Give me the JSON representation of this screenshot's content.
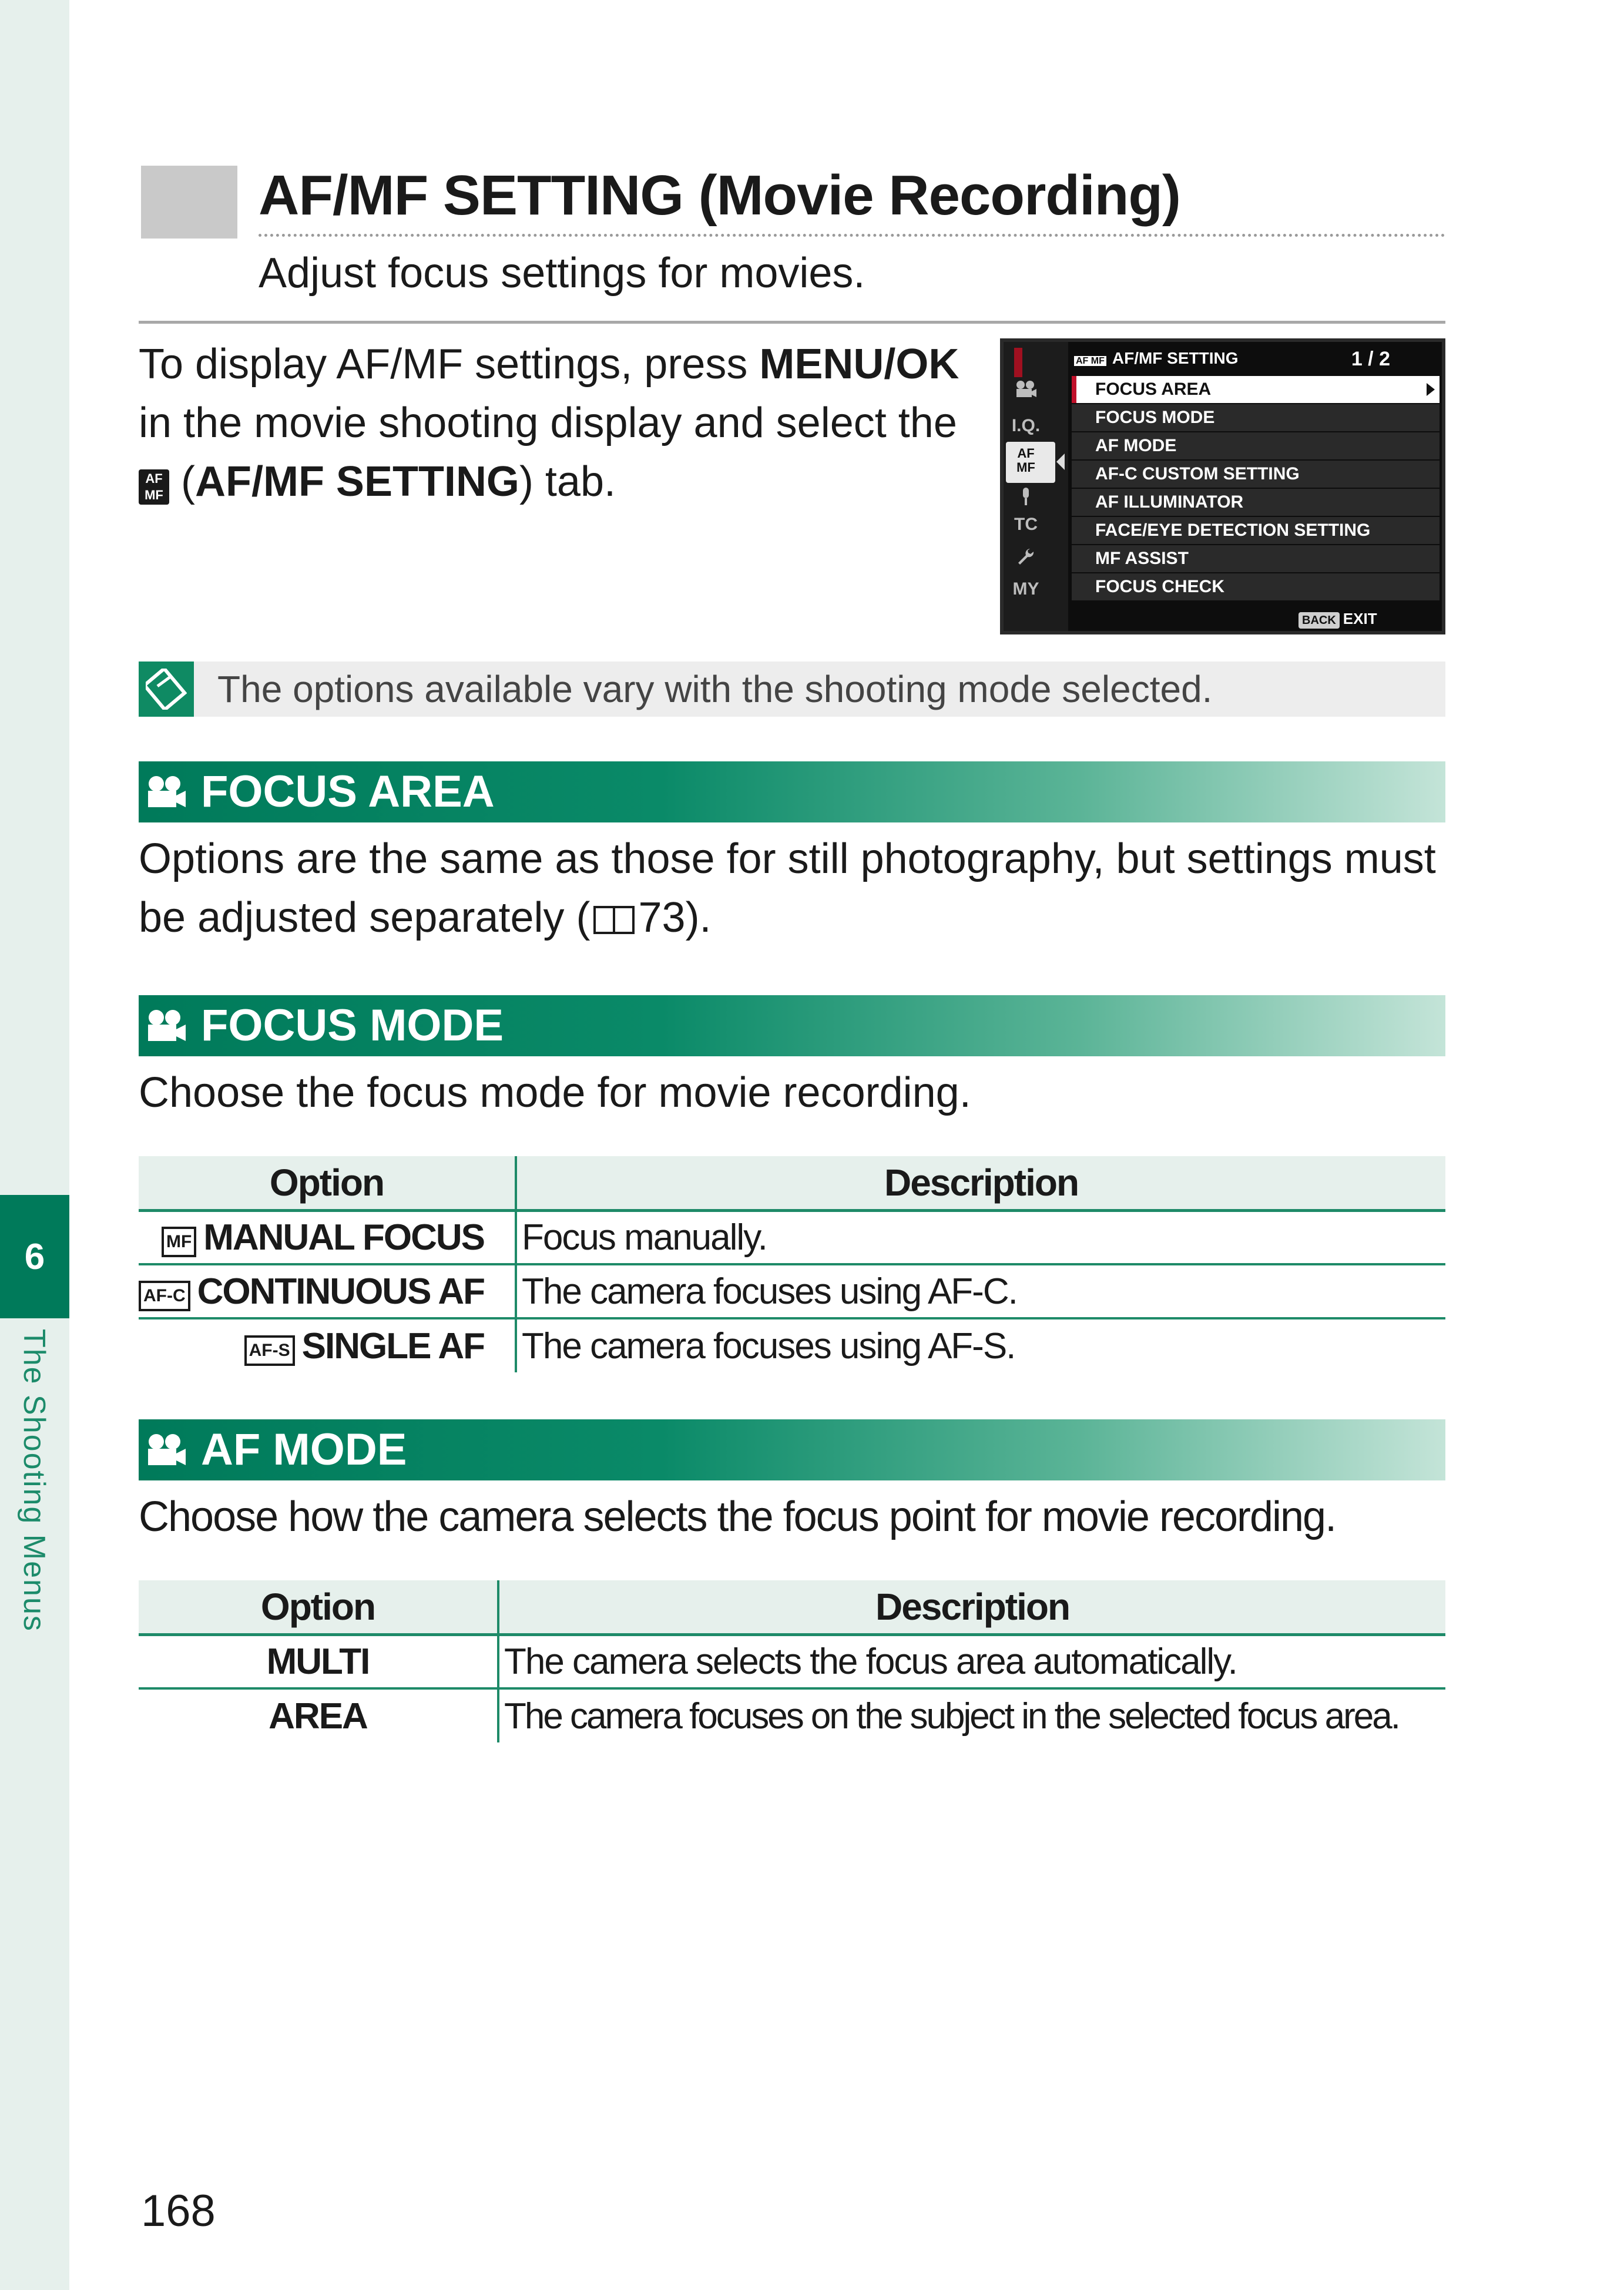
{
  "side": {
    "chapter_number": "6",
    "chapter_label": "The Shooting Menus"
  },
  "header": {
    "title": "AF/MF SETTING (Movie Recording)",
    "subtitle": "Adjust focus settings for movies."
  },
  "intro": {
    "part1": "To display AF/MF settings, press ",
    "key": "MENU/OK",
    "part2": " in the movie shooting display and select the ",
    "tab_icon": "AF MF",
    "part3": " (",
    "tab_name": "AF/MF SETTING",
    "part4": ") tab."
  },
  "camera_screen": {
    "tab_icon": "AF MF",
    "title": "AF/MF SETTING",
    "page": "1 / 2",
    "side_icons": [
      "movie-icon",
      "I.Q.",
      "AF MF",
      "audio-icon",
      "TC",
      "wrench-icon",
      "MY"
    ],
    "items": [
      "FOCUS AREA",
      "FOCUS MODE",
      "AF MODE",
      "AF-C CUSTOM SETTING",
      "AF ILLUMINATOR",
      "FACE/EYE DETECTION SETTING",
      "MF ASSIST",
      "FOCUS CHECK"
    ],
    "selected_item": "FOCUS AREA",
    "back_label": "BACK",
    "exit_label": "EXIT"
  },
  "note": {
    "icon": "note-icon",
    "text": "The options available vary with the shooting mode selected."
  },
  "sections": {
    "focus_area": {
      "title": "FOCUS AREA",
      "text_before": "Options are the same as those for still photography, but settings must be adjusted separately (",
      "page_ref": "73",
      "text_after": ")."
    },
    "focus_mode": {
      "title": "FOCUS MODE",
      "text": "Choose the focus mode for movie recording.",
      "table": {
        "headers": [
          "Option",
          "Description"
        ],
        "rows": [
          {
            "icon": "MF",
            "option": "MANUAL FOCUS",
            "description": "Focus manually."
          },
          {
            "icon": "AF-C",
            "option": "CONTINUOUS AF",
            "description": "The camera focuses using AF-C."
          },
          {
            "icon": "AF-S",
            "option": "SINGLE AF",
            "description": "The camera focuses using AF-S."
          }
        ]
      }
    },
    "af_mode": {
      "title": "AF MODE",
      "text": "Choose how the camera selects the focus point for movie recording.",
      "table": {
        "headers": [
          "Option",
          "Description"
        ],
        "rows": [
          {
            "option": "MULTI",
            "description": "The camera selects the focus area automatically."
          },
          {
            "option": "AREA",
            "description": "The camera focuses on the subject in the selected focus area."
          }
        ]
      }
    }
  },
  "footer": {
    "page_number": "168"
  }
}
